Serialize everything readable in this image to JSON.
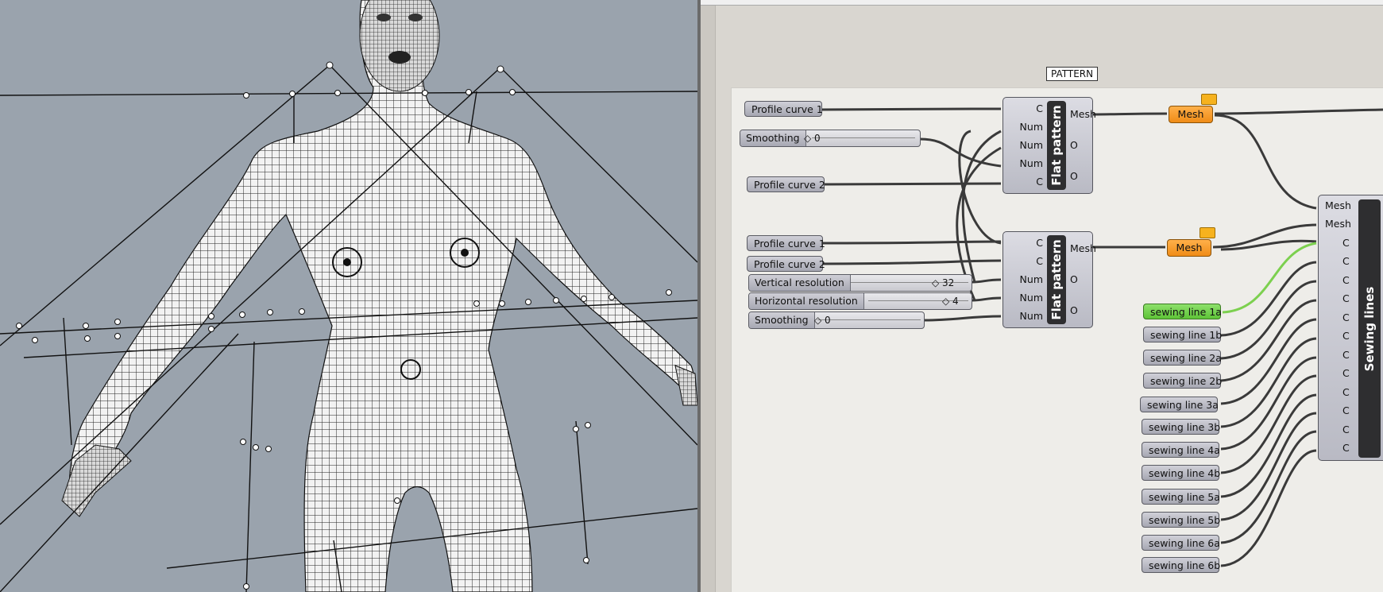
{
  "group": {
    "label": "PATTERN"
  },
  "top_params": {
    "profile1": "Profile curve 1",
    "profile2": "Profile curve 2"
  },
  "top_slider": {
    "label": "Smoothing",
    "value": "◇ 0"
  },
  "bottom_params": {
    "profile1": "Profile curve 1",
    "profile2": "Profile curve 2"
  },
  "bottom_sliders": [
    {
      "label": "Vertical resolution",
      "value": "◇ 32"
    },
    {
      "label": "Horizontal resolution",
      "value": "◇ 4"
    },
    {
      "label": "Smoothing",
      "value": "◇ 0"
    }
  ],
  "flat_pattern_1": {
    "name": "Flat pattern",
    "inputs": [
      "C",
      "Num",
      "Num",
      "Num",
      "C"
    ],
    "outputs": [
      "Mesh",
      "O",
      "O"
    ]
  },
  "flat_pattern_2": {
    "name": "Flat pattern",
    "inputs": [
      "C",
      "C",
      "Num",
      "Num",
      "Num"
    ],
    "outputs": [
      "Mesh",
      "O",
      "O"
    ]
  },
  "mesh_params": [
    "Mesh",
    "Mesh"
  ],
  "sewing_component": {
    "name": "Sewing lines",
    "inputs": [
      "Mesh",
      "Mesh",
      "C",
      "C",
      "C",
      "C",
      "C",
      "C",
      "C",
      "C",
      "C",
      "C",
      "C",
      "C"
    ]
  },
  "sewing_lines": [
    "sewing line 1a",
    "sewing line 1b",
    "sewing line 2a",
    "sewing line 2b",
    "sewing line 3a",
    "sewing line 3b",
    "sewing line 4a",
    "sewing line 4b",
    "sewing line 5a",
    "sewing line 5b",
    "sewing line 6a",
    "sewing line 6b"
  ],
  "colors": {
    "viewport_bg": "#9aa3ad",
    "canvas_bg": "#eeede9",
    "param_gray": "#b4b5bf",
    "mesh_orange": "#f39a22",
    "selected_green": "#6cd043",
    "wire": "#3a3a3a",
    "wire_selected": "#7cd04f"
  }
}
